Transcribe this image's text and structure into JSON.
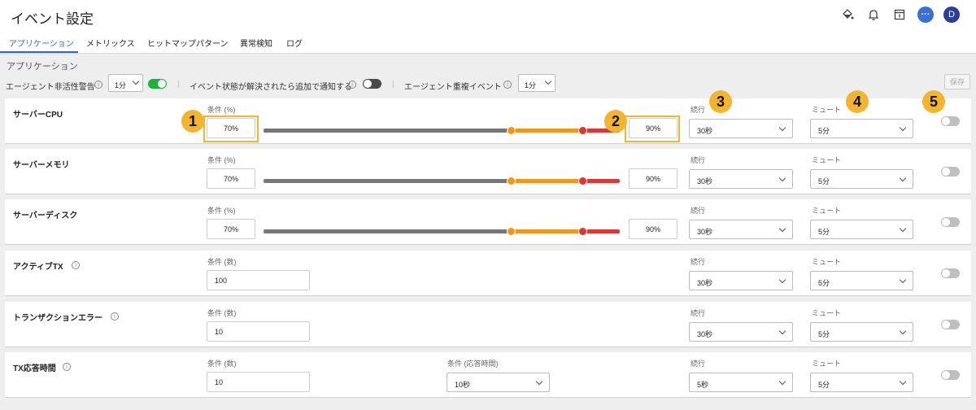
{
  "header": {
    "title": "イベント設定",
    "avatar_initial": "D",
    "chat_glyph": "···"
  },
  "tabs": [
    {
      "label": "アプリケーション",
      "active": true
    },
    {
      "label": "メトリックス"
    },
    {
      "label": "ヒットマップパターン"
    },
    {
      "label": "異常検知"
    },
    {
      "label": "ログ"
    }
  ],
  "section_title": "アプリケーション",
  "options": {
    "inactive_alert_label": "エージェント非活性警告",
    "inactive_alert_value": "1分",
    "inactive_alert_enabled": true,
    "resolved_notify_label": "イベント状態が解決されたら追加で通知する",
    "resolved_notify_enabled": false,
    "duplicate_label": "エージェント重複イベント",
    "duplicate_value": "1分",
    "separator": "|",
    "info_glyph": "i",
    "save_label": "保存"
  },
  "labels": {
    "cond_pct": "条件 (%)",
    "cond_count": "条件 (数)",
    "cond_resp": "条件 (応答時間)",
    "duration": "続行",
    "mute": "ミュート"
  },
  "rows": [
    {
      "name": "サーバーCPU",
      "low": "70%",
      "high": "90%",
      "duration": "30秒",
      "mute": "5分",
      "enabled": false
    },
    {
      "name": "サーバーメモリ",
      "low": "70%",
      "high": "90%",
      "duration": "30秒",
      "mute": "5分",
      "enabled": false
    },
    {
      "name": "サーバーディスク",
      "low": "70%",
      "high": "90%",
      "duration": "30秒",
      "mute": "5分",
      "enabled": false
    },
    {
      "name": "アクティブTX",
      "count": "100",
      "duration": "30秒",
      "mute": "5分",
      "enabled": false
    },
    {
      "name": "トランザクションエラー",
      "count": "10",
      "duration": "30秒",
      "mute": "5分",
      "enabled": false
    },
    {
      "name": "TX応答時間",
      "count": "10",
      "resp": "10秒",
      "duration": "5秒",
      "mute": "5分",
      "enabled": false
    }
  ],
  "annotations": [
    "1",
    "2",
    "3",
    "4",
    "5"
  ],
  "colors": {
    "accent": "#2c66d8",
    "highlight": "#f3b52f",
    "toggle_on": "#1bb33a",
    "warning": "#f5961c",
    "critical": "#e03535"
  },
  "icons": [
    "paint-bucket-icon",
    "bell-icon",
    "document-icon",
    "chat-icon",
    "avatar",
    "info-icon",
    "chevron-down-icon"
  ]
}
